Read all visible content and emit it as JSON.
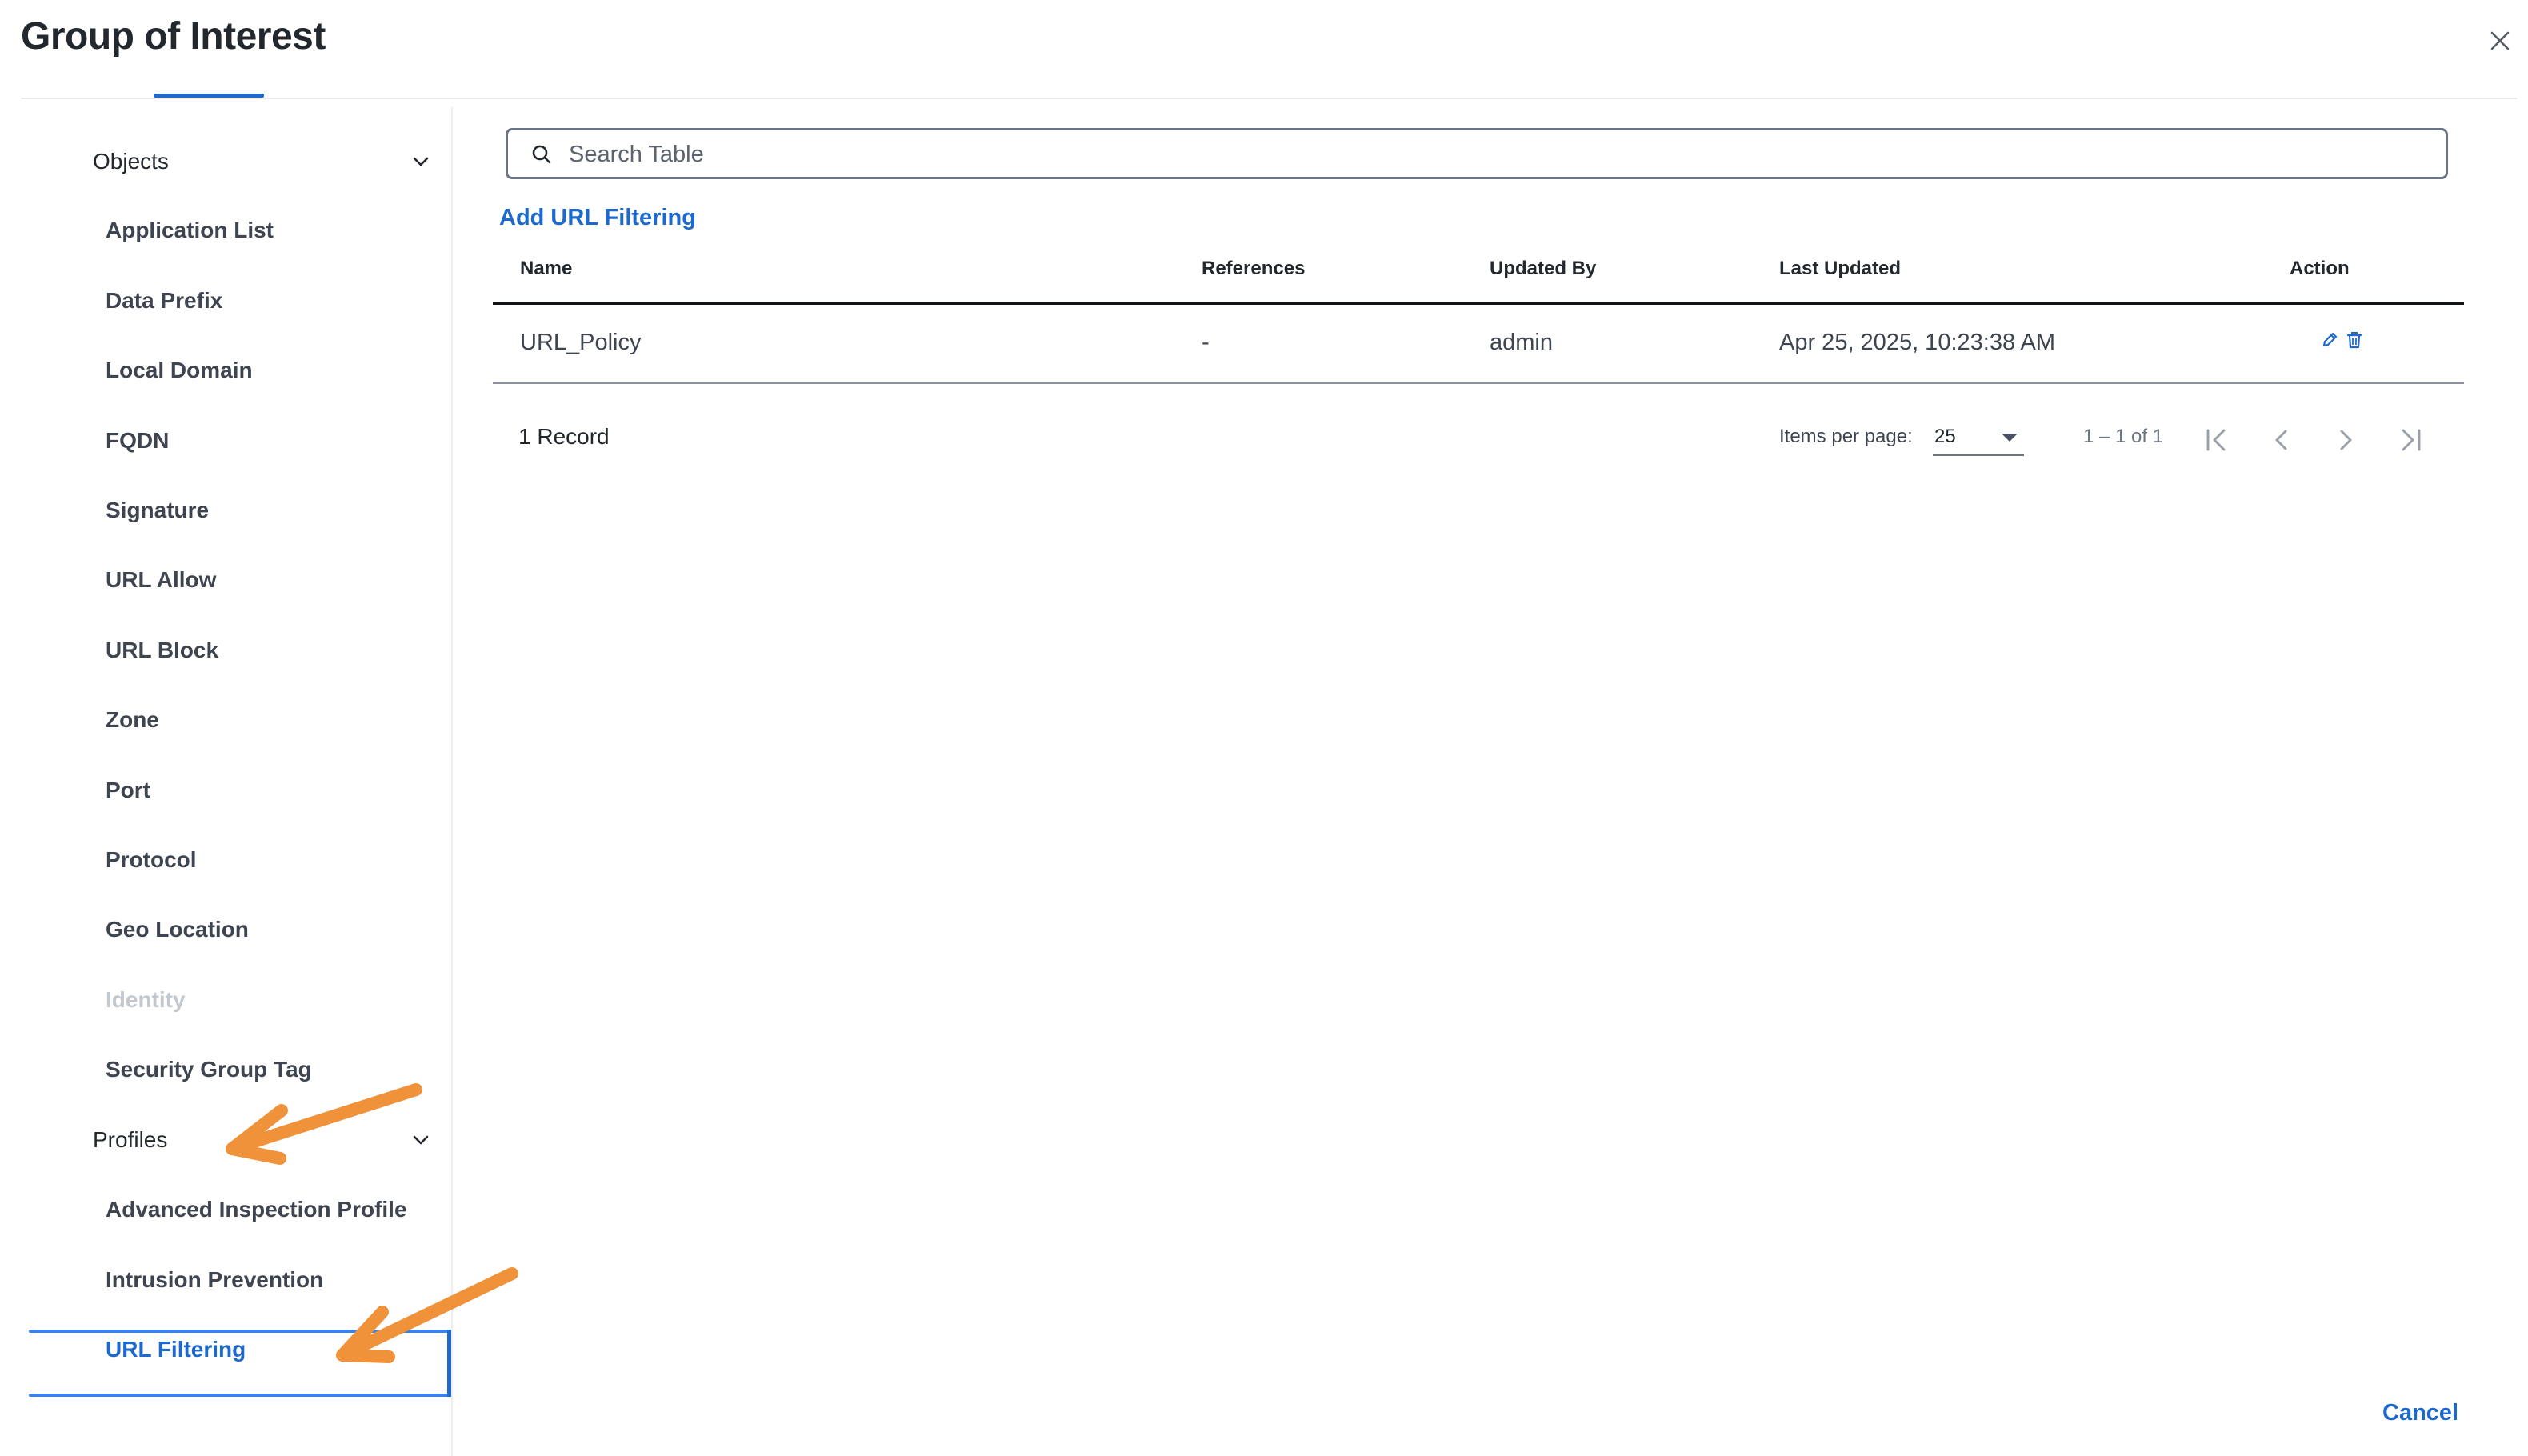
{
  "dialog": {
    "title": "Group of Interest",
    "close_icon": "close-icon"
  },
  "sidebar": {
    "groups": [
      {
        "label": "Objects",
        "icon": "chevron-down-icon",
        "items": [
          {
            "label": "Application List"
          },
          {
            "label": "Data Prefix"
          },
          {
            "label": "Local Domain"
          },
          {
            "label": "FQDN"
          },
          {
            "label": "Signature"
          },
          {
            "label": "URL Allow"
          },
          {
            "label": "URL Block"
          },
          {
            "label": "Zone"
          },
          {
            "label": "Port"
          },
          {
            "label": "Protocol"
          },
          {
            "label": "Geo Location"
          },
          {
            "label": "Identity",
            "disabled": true
          },
          {
            "label": "Security Group Tag"
          }
        ]
      },
      {
        "label": "Profiles",
        "icon": "chevron-down-icon",
        "items": [
          {
            "label": "Advanced Inspection Profile"
          },
          {
            "label": "Intrusion Prevention"
          },
          {
            "label": "URL Filtering",
            "active": true
          }
        ]
      }
    ]
  },
  "search": {
    "placeholder": "Search Table",
    "value": "",
    "icon": "search-icon"
  },
  "add_link": "Add URL Filtering",
  "table": {
    "columns": [
      "Name",
      "References",
      "Updated By",
      "Last Updated",
      "Action"
    ],
    "rows": [
      {
        "name": "URL_Policy",
        "references": "-",
        "updated_by": "admin",
        "last_updated": "Apr 25, 2025, 10:23:38 AM",
        "actions": [
          "edit-icon",
          "delete-icon"
        ]
      }
    ]
  },
  "pagination": {
    "records": "1 Record",
    "items_per_page_label": "Items per page:",
    "items_per_page": "25",
    "range": "1 – 1 of 1",
    "buttons": [
      "first-page-icon",
      "previous-page-icon",
      "next-page-icon",
      "last-page-icon"
    ]
  },
  "footer": {
    "cancel_label": "Cancel"
  },
  "colors": {
    "accent": "#1d69cc",
    "annotation_arrow": "#f0923a",
    "text": "#23282e",
    "disabled": "#c3c8cf"
  }
}
